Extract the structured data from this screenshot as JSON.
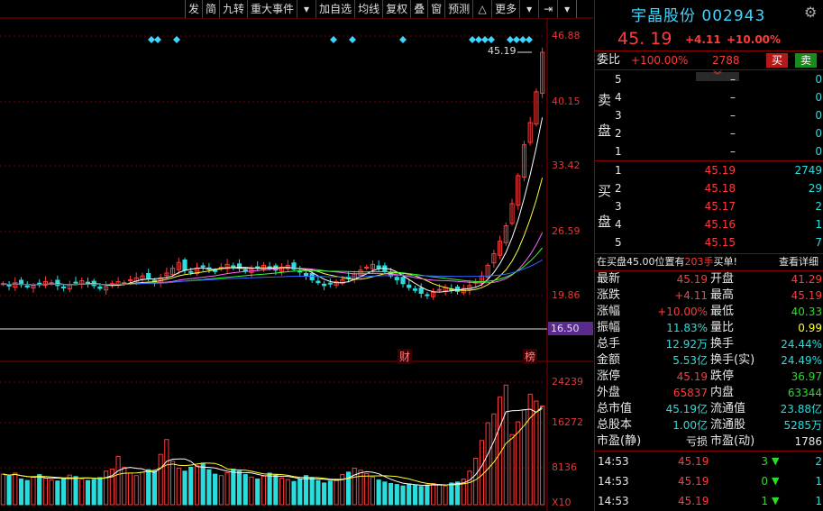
{
  "toolbar": {
    "items": [
      "发",
      "简",
      "九转",
      "重大事件",
      "加自选",
      "均线",
      "复权",
      "叠",
      "窗",
      "预测",
      "更多"
    ]
  },
  "header": {
    "stock_name": "宇晶股份",
    "code": "002943",
    "price": "45. 19",
    "change": "+4.11",
    "change_pct": "+10.00%"
  },
  "weibi": {
    "label": "委比",
    "ratio": "+100.00%",
    "diff": "2788",
    "buy_btn": "买",
    "sell_btn": "卖"
  },
  "sell_side": {
    "label_1": "卖",
    "label_2": "盘",
    "levels": [
      {
        "n": "5",
        "price": "–",
        "vol": "0"
      },
      {
        "n": "4",
        "price": "–",
        "vol": "0"
      },
      {
        "n": "3",
        "price": "–",
        "vol": "0"
      },
      {
        "n": "2",
        "price": "–",
        "vol": "0"
      },
      {
        "n": "1",
        "price": "–",
        "vol": "0"
      }
    ]
  },
  "buy_side": {
    "label_1": "买",
    "label_2": "盘",
    "levels": [
      {
        "n": "1",
        "price": "45.19",
        "vol": "2749"
      },
      {
        "n": "2",
        "price": "45.18",
        "vol": "29"
      },
      {
        "n": "3",
        "price": "45.17",
        "vol": "2"
      },
      {
        "n": "4",
        "price": "45.16",
        "vol": "1"
      },
      {
        "n": "5",
        "price": "45.15",
        "vol": "7"
      }
    ]
  },
  "notice": {
    "pre": "在买盘45.00位置有",
    "qty": "203手",
    "post": "买单!",
    "link": "查看详细"
  },
  "stats": [
    {
      "l1": "最新",
      "v1": "45.19",
      "c1": "red",
      "l2": "开盘",
      "v2": "41.29",
      "c2": "red"
    },
    {
      "l1": "涨跌",
      "v1": "+4.11",
      "c1": "red",
      "l2": "最高",
      "v2": "45.19",
      "c2": "red"
    },
    {
      "l1": "涨幅",
      "v1": "+10.00%",
      "c1": "red",
      "l2": "最低",
      "v2": "40.33",
      "c2": "green"
    },
    {
      "l1": "振幅",
      "v1": "11.83%",
      "c1": "cyan",
      "l2": "量比",
      "v2": "0.99",
      "c2": "yellow"
    },
    {
      "l1": "总手",
      "v1": "12.92万",
      "c1": "cyan",
      "l2": "换手",
      "v2": "24.44%",
      "c2": "cyan"
    },
    {
      "l1": "金额",
      "v1": "5.53亿",
      "c1": "cyan",
      "l2": "换手(实)",
      "v2": "24.49%",
      "c2": "cyan"
    },
    {
      "l1": "涨停",
      "v1": "45.19",
      "c1": "red",
      "l2": "跌停",
      "v2": "36.97",
      "c2": "green"
    },
    {
      "l1": "外盘",
      "v1": "65837",
      "c1": "red",
      "l2": "内盘",
      "v2": "63344",
      "c2": "green"
    },
    {
      "l1": "总市值",
      "v1": "45.19亿",
      "c1": "cyan",
      "l2": "流通值",
      "v2": "23.88亿",
      "c2": "cyan"
    },
    {
      "l1": "总股本",
      "v1": "1.00亿",
      "c1": "cyan",
      "l2": "流通股",
      "v2": "5285万",
      "c2": "cyan"
    },
    {
      "l1": "市盈(静)",
      "v1": "亏损",
      "c1": "white",
      "l2": "市盈(动)",
      "v2": "1786",
      "c2": "white"
    }
  ],
  "ticks": [
    {
      "time": "14:53",
      "price": "45.19",
      "vol": "3",
      "dir": "down",
      "n": "2"
    },
    {
      "time": "14:53",
      "price": "45.19",
      "vol": "0",
      "dir": "down",
      "n": "1"
    },
    {
      "time": "14:53",
      "price": "45.19",
      "vol": "1",
      "dir": "down",
      "n": "1"
    }
  ],
  "price_axis": [
    "46.88",
    "40.15",
    "33.42",
    "26.59",
    "19.86"
  ],
  "price_marker": "16.50",
  "vol_axis": [
    "24239",
    "16272",
    "8136"
  ],
  "vol_unit": "X10",
  "last_price_label": "45.19",
  "event_labels": [
    "财",
    "榜"
  ],
  "colors": {
    "up": "#ff3b3b",
    "down": "#2bdcdc",
    "ma5": "#ffffff",
    "ma10": "#ffff33",
    "ma20": "#ff66ff",
    "ma30": "#33ff33",
    "ma60": "#3366ff"
  },
  "chart_data": {
    "type": "candlestick",
    "ylim": [
      16.5,
      46.88
    ],
    "close_approx": [
      21.2,
      21.0,
      21.3,
      21.1,
      20.9,
      21.0,
      21.2,
      21.4,
      21.3,
      21.0,
      20.8,
      21.1,
      21.3,
      21.5,
      21.2,
      21.0,
      20.7,
      20.9,
      21.2,
      21.4,
      21.3,
      21.6,
      21.8,
      22.0,
      21.7,
      21.4,
      21.8,
      22.3,
      22.8,
      23.4,
      22.6,
      22.4,
      22.8,
      23.0,
      22.7,
      22.5,
      22.9,
      23.2,
      23.0,
      22.8,
      22.5,
      22.7,
      22.9,
      23.1,
      22.8,
      22.6,
      22.9,
      23.1,
      22.7,
      22.4,
      22.0,
      21.6,
      21.3,
      21.0,
      21.2,
      21.4,
      21.6,
      21.8,
      22.2,
      22.6,
      22.9,
      23.2,
      22.8,
      22.5,
      22.0,
      21.6,
      21.2,
      20.8,
      20.5,
      20.2,
      20.0,
      20.3,
      20.6,
      20.8,
      20.6,
      20.4,
      20.7,
      21.0,
      21.4,
      22.0,
      23.1,
      24.3,
      25.6,
      27.2,
      29.5,
      32.4,
      35.6,
      37.9,
      41.1,
      45.19
    ],
    "volume_approx": [
      6200,
      5800,
      6400,
      5200,
      4900,
      5600,
      6100,
      5400,
      5000,
      4800,
      5300,
      6000,
      5700,
      5200,
      4900,
      5100,
      5500,
      6800,
      7200,
      9800,
      7600,
      6400,
      5900,
      6600,
      7100,
      6800,
      10200,
      13200,
      8800,
      7400,
      6800,
      7600,
      7900,
      8400,
      7100,
      6200,
      5900,
      6500,
      7200,
      6800,
      6100,
      5600,
      5200,
      5800,
      6400,
      6000,
      5400,
      5100,
      4700,
      5200,
      5900,
      5400,
      4900,
      4400,
      4800,
      5200,
      6100,
      6600,
      7400,
      7000,
      6300,
      5600,
      5000,
      4600,
      4300,
      4100,
      3800,
      4200,
      3900,
      3700,
      4000,
      4300,
      4100,
      3800,
      4400,
      4600,
      5200,
      6800,
      9400,
      13000,
      16600,
      18400,
      21800,
      24239,
      14200,
      16800,
      19200,
      22400,
      21000,
      20000
    ]
  }
}
